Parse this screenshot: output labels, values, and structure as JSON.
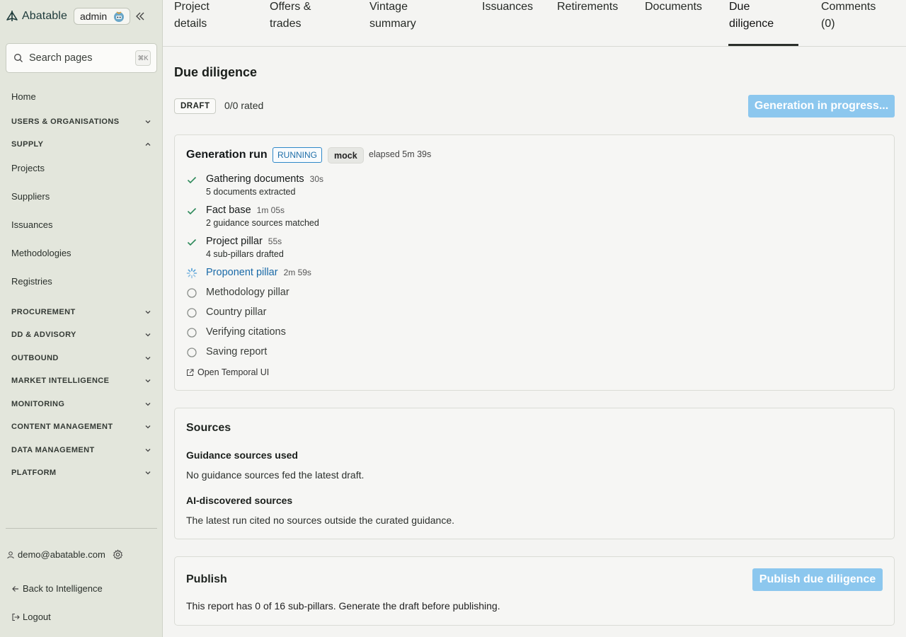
{
  "brand": {
    "name": "Abatable",
    "role": "admin"
  },
  "search": {
    "placeholder": "Search pages",
    "shortcut": "⌘K"
  },
  "nav": {
    "home": "Home",
    "users_orgs": "USERS & ORGANISATIONS",
    "supply": "SUPPLY",
    "supply_items": [
      "Projects",
      "Suppliers",
      "Issuances",
      "Methodologies",
      "Registries"
    ],
    "procurement": "PROCUREMENT",
    "dd_advisory": "DD & ADVISORY",
    "outbound": "OUTBOUND",
    "market_intelligence": "MARKET INTELLIGENCE",
    "monitoring": "MONITORING",
    "content_management": "CONTENT MANAGEMENT",
    "data_management": "DATA MANAGEMENT",
    "platform": "PLATFORM"
  },
  "footer": {
    "user_email": "demo@abatable.com",
    "back_label": "Back to Intelligence",
    "logout_label": "Logout"
  },
  "tabs": {
    "project_details": [
      "Project",
      "details"
    ],
    "offers_trades": [
      "Offers &",
      "trades"
    ],
    "vintage_summary": [
      "Vintage",
      "summary"
    ],
    "issuances": "Issuances",
    "retirements": "Retirements",
    "documents": "Documents",
    "due_diligence": [
      "Due",
      "diligence"
    ],
    "comments": [
      "Comments",
      "(0)"
    ]
  },
  "page": {
    "title": "Due diligence",
    "draft_badge": "DRAFT",
    "rated": "0/0 rated",
    "generate_button": "Generation in progress..."
  },
  "run": {
    "title": "Generation run",
    "status": "RUNNING",
    "mode": "mock",
    "elapsed": "elapsed 5m 39s",
    "steps": [
      {
        "name": "Gathering documents",
        "time": "30s",
        "detail": "5 documents extracted"
      },
      {
        "name": "Fact base",
        "time": "1m 05s",
        "detail": "2 guidance sources matched"
      },
      {
        "name": "Project pillar",
        "time": "55s",
        "detail": "4 sub-pillars drafted"
      },
      {
        "name": "Proponent pillar",
        "time": "2m 59s"
      },
      {
        "name": "Methodology pillar"
      },
      {
        "name": "Country pillar"
      },
      {
        "name": "Verifying citations"
      },
      {
        "name": "Saving report"
      }
    ],
    "temporal_link": "Open Temporal UI"
  },
  "sources": {
    "title": "Sources",
    "guidance_heading": "Guidance sources used",
    "guidance_text": "No guidance sources fed the latest draft.",
    "ai_heading": "AI-discovered sources",
    "ai_text": "The latest run cited no sources outside the curated guidance."
  },
  "publish": {
    "title": "Publish",
    "button": "Publish due diligence",
    "text": "This report has 0 of 16 sub-pillars. Generate the draft before publishing."
  },
  "colors": {
    "accent": "#8cc7ee",
    "running": "#1f6fa9",
    "success": "#2e8a5b",
    "sidebar_bg": "#e3e6dc"
  }
}
